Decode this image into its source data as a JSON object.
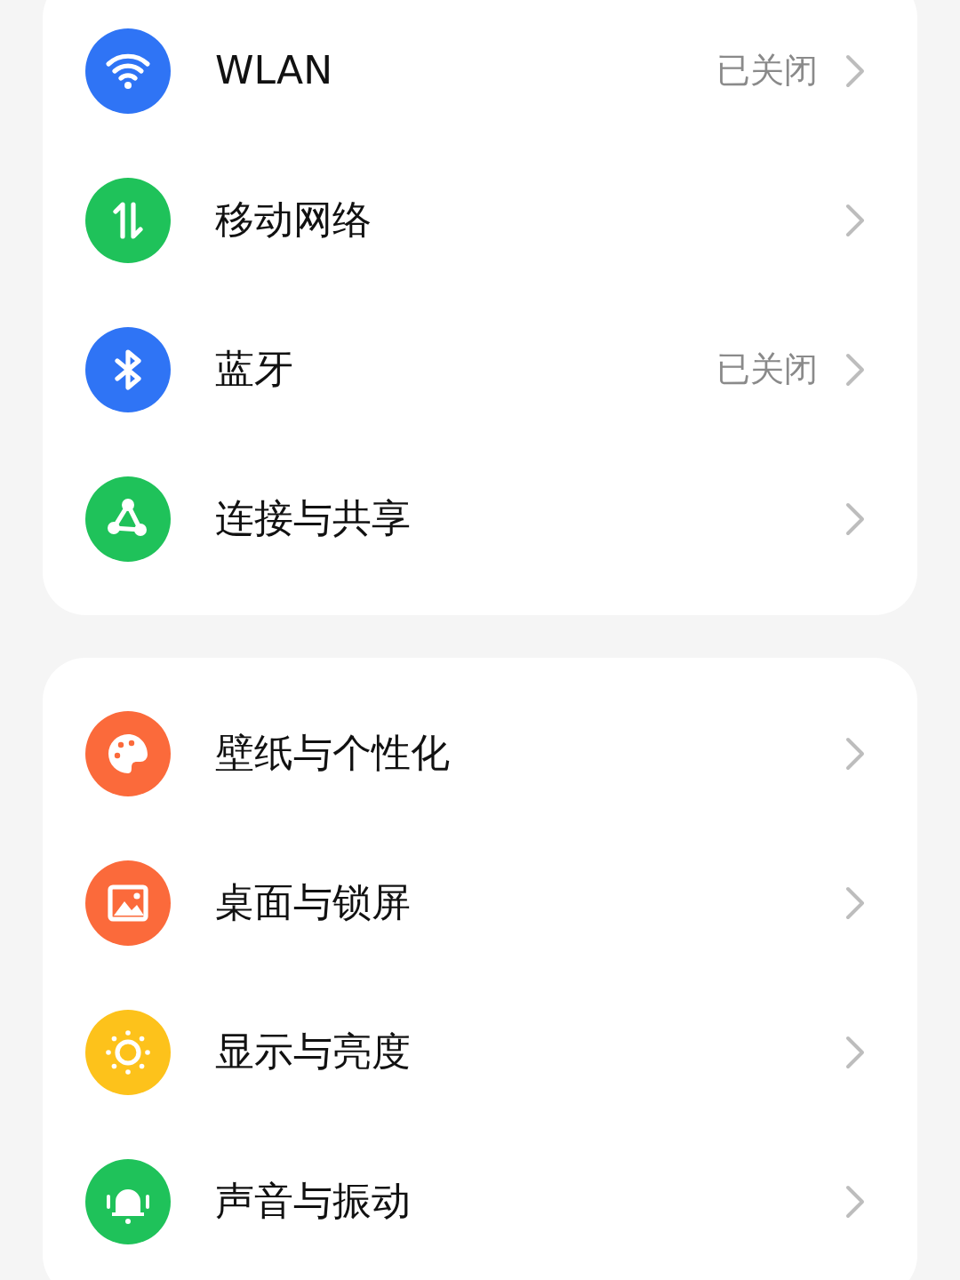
{
  "sections": [
    {
      "items": [
        {
          "label": "WLAN",
          "status": "已关闭"
        },
        {
          "label": "移动网络"
        },
        {
          "label": "蓝牙",
          "status": "已关闭"
        },
        {
          "label": "连接与共享"
        }
      ]
    },
    {
      "items": [
        {
          "label": "壁纸与个性化"
        },
        {
          "label": "桌面与锁屏"
        },
        {
          "label": "显示与亮度"
        },
        {
          "label": "声音与振动"
        }
      ]
    }
  ]
}
